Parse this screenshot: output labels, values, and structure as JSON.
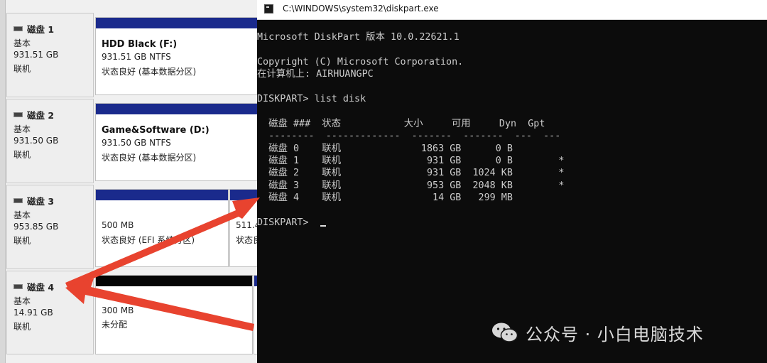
{
  "disk_management": {
    "disks": [
      {
        "name": "磁盘 1",
        "type": "基本",
        "size": "931.51 GB",
        "status": "联机"
      },
      {
        "name": "磁盘 2",
        "type": "基本",
        "size": "931.50 GB",
        "status": "联机"
      },
      {
        "name": "磁盘 3",
        "type": "基本",
        "size": "953.85 GB",
        "status": "联机"
      },
      {
        "name": "磁盘 4",
        "type": "基本",
        "size": "14.91 GB",
        "status": "联机"
      }
    ],
    "partitions": {
      "disk1_main": {
        "name": "HDD Black  (F:)",
        "size": "931.51 GB NTFS",
        "status": "状态良好 (基本数据分区)"
      },
      "disk2_main": {
        "name": "Game&Software  (D:)",
        "size": "931.50 GB NTFS",
        "status": "状态良好 (基本数据分区)"
      },
      "disk3_efi": {
        "size": "500 MB",
        "status": "状态良好 (EFI 系统分区)"
      },
      "disk3_second": {
        "size": "511.4",
        "status": "状态良"
      },
      "disk4_first": {
        "size": "300 MB",
        "status": "未分配"
      }
    }
  },
  "console": {
    "title": "C:\\WINDOWS\\system32\\diskpart.exe",
    "output": "Microsoft DiskPart 版本 10.0.22621.1\n\nCopyright (C) Microsoft Corporation.\n在计算机上: AIRHUANGPC\n\nDISKPART> list disk\n\n  磁盘 ###  状态           大小     可用     Dyn  Gpt\n  --------  -------------  -------  -------  ---  ---\n  磁盘 0    联机              1863 GB      0 B\n  磁盘 1    联机               931 GB      0 B        *\n  磁盘 2    联机               931 GB  1024 KB        *\n  磁盘 3    联机               953 GB  2048 KB        *\n  磁盘 4    联机                14 GB   299 MB\n\nDISKPART> "
  },
  "watermark": {
    "text": "公众号 · 小白电脑技术"
  },
  "colors": {
    "partition_bar": "#1a2a8c",
    "unallocated_bar": "#050505",
    "arrow": "#e8432f",
    "console_bg": "#0c0c0c"
  },
  "icons": {
    "disk": "disk-drive-icon",
    "console": "console-window-icon",
    "watermark": "wechat-icon"
  }
}
